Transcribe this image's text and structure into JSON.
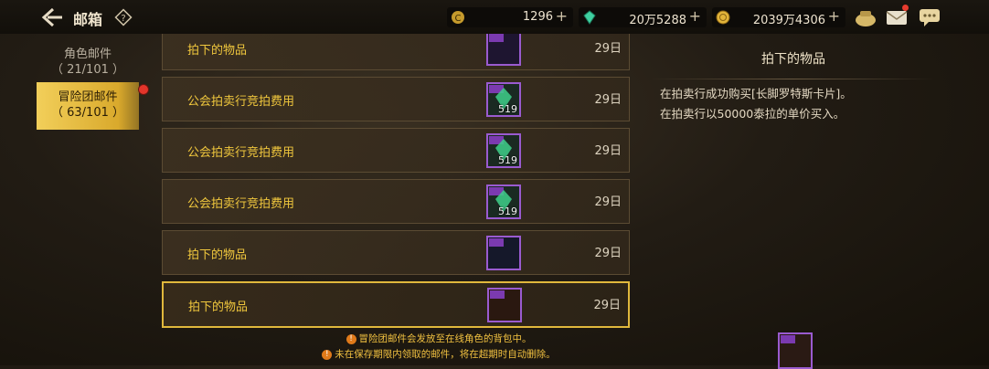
{
  "header": {
    "title": "邮箱",
    "back_icon": "back-arrow-icon",
    "help_icon": "help-icon"
  },
  "currencies": [
    {
      "icon": "gold-coin-icon",
      "value": "1296",
      "plus": "+"
    },
    {
      "icon": "green-crystal-icon",
      "value": "20万5288",
      "plus": "+"
    },
    {
      "icon": "gold-coin-icon",
      "value": "2039万4306",
      "plus": "+"
    }
  ],
  "top_icons": [
    "bag-icon",
    "mail-icon",
    "chat-icon"
  ],
  "sidebar": {
    "tabs": [
      {
        "name": "角色邮件",
        "count": "（ 21/101 ）",
        "active": false
      },
      {
        "name": "冒险团邮件",
        "count": "（ 63/101 ）",
        "active": true
      }
    ]
  },
  "mails": [
    {
      "title": "拍下的物品",
      "date": "29日",
      "thumb": "card-item",
      "num": ""
    },
    {
      "title": "公会拍卖行竞拍费用",
      "date": "29日",
      "thumb": "crystal-item",
      "num": "519"
    },
    {
      "title": "公会拍卖行竞拍费用",
      "date": "29日",
      "thumb": "crystal-item",
      "num": "519"
    },
    {
      "title": "公会拍卖行竞拍费用",
      "date": "29日",
      "thumb": "crystal-item",
      "num": "519"
    },
    {
      "title": "拍下的物品",
      "date": "29日",
      "thumb": "card-item",
      "num": ""
    },
    {
      "title": "拍下的物品",
      "date": "29日",
      "thumb": "card-item",
      "num": "",
      "selected": true
    }
  ],
  "detail": {
    "title": "拍下的物品",
    "lines": [
      "在拍卖行成功购买[长脚罗特斯卡片]。",
      "在拍卖行以50000泰拉的单价买入。"
    ]
  },
  "notes": [
    "冒险团邮件会发放至在线角色的背包中。",
    "未在保存期限内领取的邮件，将在超期时自动删除。"
  ],
  "colors": {
    "accent_gold": "#f0c73d",
    "selected_border": "#e0b83c",
    "notification_red": "#e3352a"
  }
}
